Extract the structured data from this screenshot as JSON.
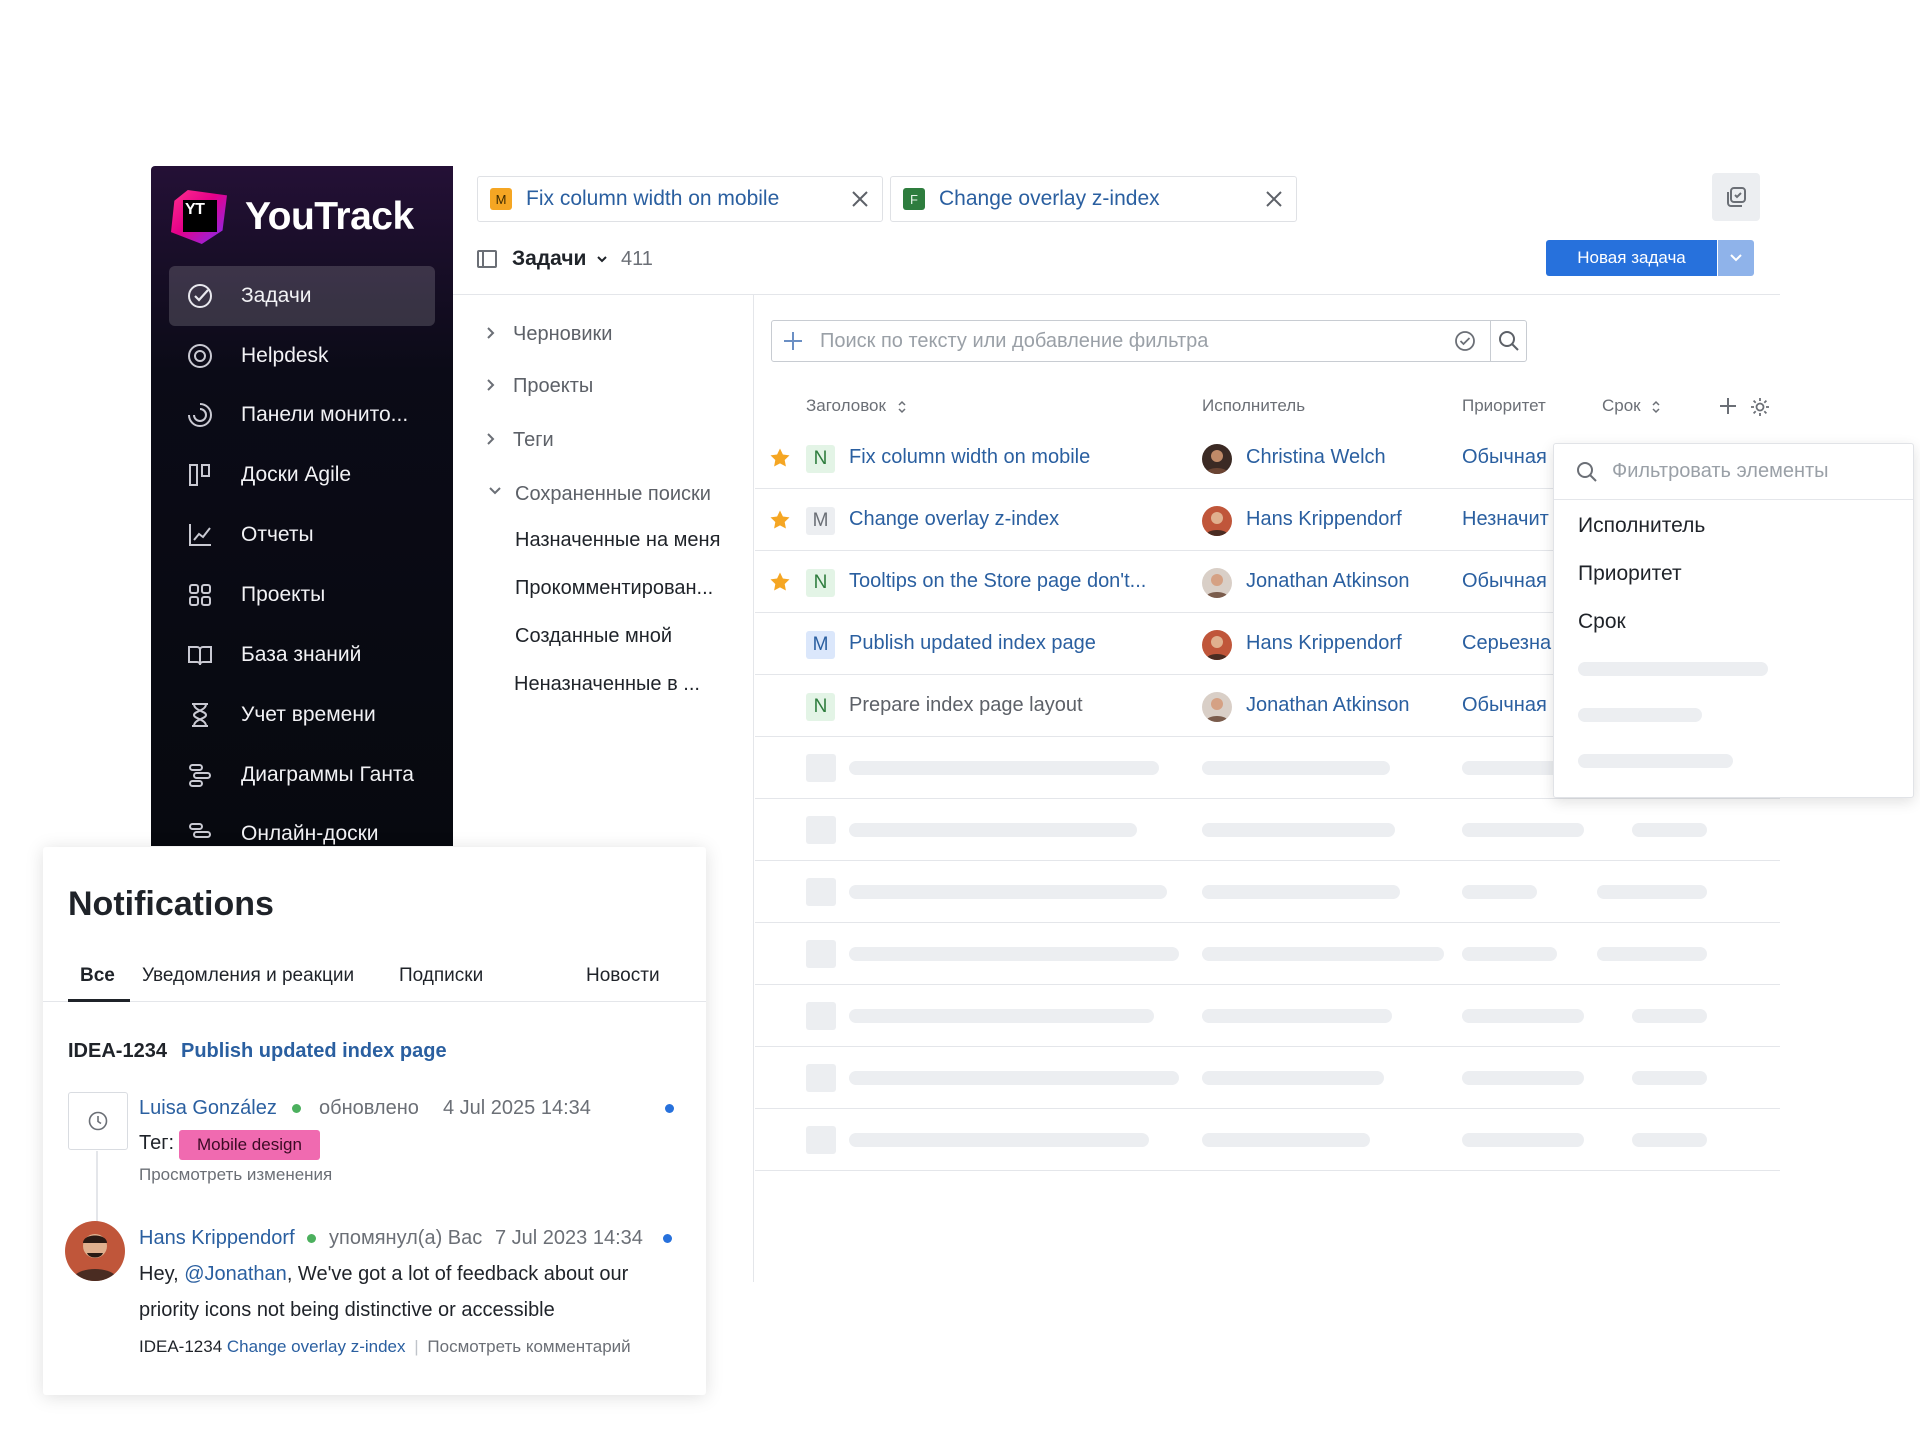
{
  "app": {
    "name": "YouTrack"
  },
  "sidebar": {
    "items": [
      {
        "label": "Задачи",
        "icon": "check-circle-icon",
        "active": true
      },
      {
        "label": "Helpdesk",
        "icon": "lifebuoy-icon"
      },
      {
        "label": "Панели монито...",
        "icon": "dashboard-icon"
      },
      {
        "label": "Доски Agile",
        "icon": "agile-board-icon"
      },
      {
        "label": "Отчеты",
        "icon": "chart-icon"
      },
      {
        "label": "Проекты",
        "icon": "grid-icon"
      },
      {
        "label": "База знаний",
        "icon": "book-icon"
      },
      {
        "label": "Учет времени",
        "icon": "hourglass-icon"
      },
      {
        "label": "Диаграммы Ганта",
        "icon": "gantt-icon"
      },
      {
        "label": "Онлайн-доски",
        "icon": "whiteboard-icon"
      }
    ]
  },
  "tabs": [
    {
      "badge": "M",
      "badge_color": "#f5a623",
      "title": "Fix column width on mobile"
    },
    {
      "badge": "F",
      "badge_color": "#2e7d3e",
      "title": "Change overlay z-index"
    }
  ],
  "header": {
    "title": "Задачи",
    "count": "411",
    "new_issue_label": "Новая задача"
  },
  "tree": {
    "folders": [
      "Черновики",
      "Проекты",
      "Теги",
      "Сохраненные поиски"
    ],
    "saved_searches": [
      "Назначенные на меня",
      "Прокомментирован...",
      "Созданные мной",
      "Неназначенные в ..."
    ]
  },
  "search": {
    "placeholder": "Поиск по тексту или добавление фильтра"
  },
  "columns": {
    "summary": "Заголовок",
    "assignee": "Исполнитель",
    "priority": "Приоритет",
    "due": "Срок"
  },
  "issues": [
    {
      "starred": true,
      "type": "N",
      "summary": "Fix column width on mobile",
      "assignee": "Christina Welch",
      "priority": "Обычная",
      "link": true
    },
    {
      "starred": true,
      "type": "M",
      "summary": "Change overlay z-index",
      "assignee": "Hans Krippendorf",
      "priority": "Незначит",
      "link": true
    },
    {
      "starred": true,
      "type": "N",
      "summary": "Tooltips on the Store page don't...",
      "assignee": "Jonathan Atkinson",
      "priority": "Обычная",
      "link": true
    },
    {
      "starred": false,
      "type": "M",
      "summary": "Publish updated index page",
      "assignee": "Hans Krippendorf",
      "priority": "Серьезна",
      "link": true
    },
    {
      "starred": false,
      "type": "N",
      "summary": "Prepare index page layout",
      "assignee": "Jonathan Atkinson",
      "priority": "Обычная",
      "link": false
    }
  ],
  "column_dropdown": {
    "placeholder": "Фильтровать элементы",
    "items": [
      "Исполнитель",
      "Приоритет",
      "Срок"
    ]
  },
  "notifications": {
    "title": "Notifications",
    "tabs": [
      "Все",
      "Уведомления и реакции",
      "Подписки",
      "Новости"
    ],
    "issue_id": "IDEA-1234",
    "issue_title": "Publish updated index page",
    "events": [
      {
        "user": "Luisa González",
        "action": "обновлено",
        "time": "4 Jul 2025 14:34",
        "field_label": "Тег:",
        "tag": "Mobile design",
        "link_text": "Просмотреть изменения"
      },
      {
        "user": "Hans Krippendorf",
        "action": "упомянул(а) Вас",
        "time": "7 Jul 2023 14:34",
        "text_prefix": "Hey, ",
        "mention": "@Jonathan",
        "text_rest": ", We've got a lot of feedback about our",
        "text_line2": "priority icons not being distinctive or accessible",
        "ref_id": "IDEA-1234",
        "ref_title": "Change overlay z-index",
        "separator": "|",
        "view_comment": "Посмотреть комментарий"
      }
    ]
  },
  "colors": {
    "accent": "#2771dc",
    "link": "#2a5fa0",
    "star": "#f5a623",
    "tag": "#f06ab0"
  }
}
